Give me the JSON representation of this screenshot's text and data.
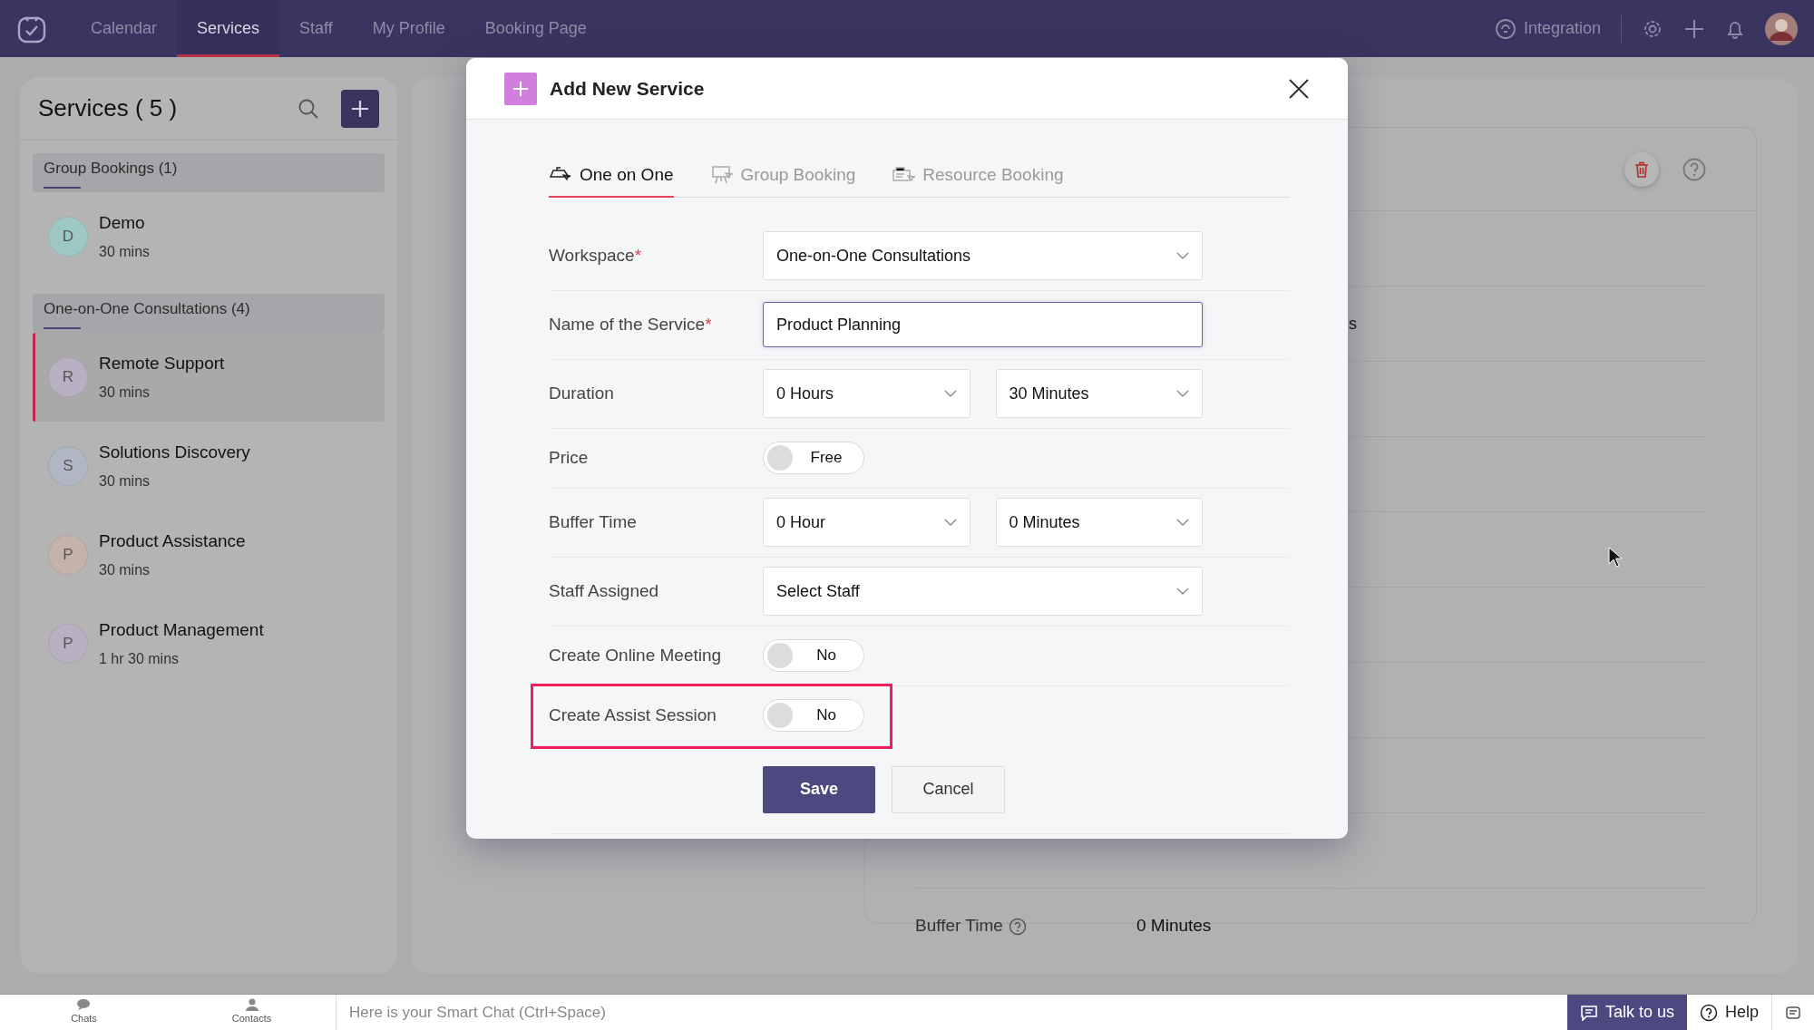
{
  "nav": {
    "items": [
      {
        "label": "Calendar",
        "selected": false
      },
      {
        "label": "Services",
        "selected": true
      },
      {
        "label": "Staff",
        "selected": false
      },
      {
        "label": "My Profile",
        "selected": false
      },
      {
        "label": "Booking Page",
        "selected": false
      }
    ],
    "integration": "Integration"
  },
  "sidebar": {
    "title": "Services ( 5 )",
    "groups": [
      {
        "name": "Group Bookings (1)",
        "services": [
          {
            "initial": "D",
            "name": "Demo",
            "duration": "30 mins",
            "color": "#9ec8c5",
            "selected": false
          }
        ]
      },
      {
        "name": "One-on-One Consultations (4)",
        "services": [
          {
            "initial": "R",
            "name": "Remote Support",
            "duration": "30 mins",
            "color": "#b9b0c4",
            "selected": true
          },
          {
            "initial": "S",
            "name": "Solutions Discovery",
            "duration": "30 mins",
            "color": "#b0b6c4",
            "selected": false
          },
          {
            "initial": "P",
            "name": "Product Assistance",
            "duration": "30 mins",
            "color": "#c4b2ab",
            "selected": false
          },
          {
            "initial": "P",
            "name": "Product Management",
            "duration": "1 hr 30 mins",
            "color": "#b9b0c4",
            "selected": false
          }
        ]
      }
    ]
  },
  "background_panel": {
    "fragment": "s",
    "rows": [
      {
        "label": "Buffer Time",
        "value": "0 Minutes"
      }
    ]
  },
  "modal": {
    "title": "Add New Service",
    "tabs": [
      {
        "label": "One on One",
        "selected": true
      },
      {
        "label": "Group Booking",
        "selected": false
      },
      {
        "label": "Resource Booking",
        "selected": false
      }
    ],
    "fields": [
      {
        "kind": "select",
        "label": "Workspace",
        "required_mark": "*",
        "values": [
          "One-on-One Consultations"
        ]
      },
      {
        "kind": "text",
        "label": "Name of the Service",
        "required_mark": "*",
        "value": "Product Planning"
      },
      {
        "kind": "select",
        "label": "Duration",
        "values": [
          "0 Hours",
          "30 Minutes"
        ]
      },
      {
        "kind": "toggle",
        "label": "Price",
        "value": "Free",
        "on": false,
        "highlighted": false
      },
      {
        "kind": "select",
        "label": "Buffer Time",
        "values": [
          "0 Hour",
          "0 Minutes"
        ]
      },
      {
        "kind": "select",
        "label": "Staff Assigned",
        "values": [
          "Select Staff"
        ]
      },
      {
        "kind": "toggle",
        "label": "Create Online Meeting",
        "value": "No",
        "on": false,
        "highlighted": false
      },
      {
        "kind": "toggle",
        "label": "Create Assist Session",
        "value": "No",
        "on": false,
        "highlighted": true
      }
    ],
    "buttons": [
      {
        "label": "Save",
        "kind": "primary"
      },
      {
        "label": "Cancel",
        "kind": "secondary"
      }
    ]
  },
  "chat_bar": {
    "items": [
      {
        "label": "Chats",
        "kind": "chats"
      },
      {
        "label": "Contacts",
        "kind": "contacts"
      }
    ],
    "placeholder": "Here is your Smart Chat (Ctrl+Space)",
    "talk": "Talk to us",
    "help": "Help"
  }
}
